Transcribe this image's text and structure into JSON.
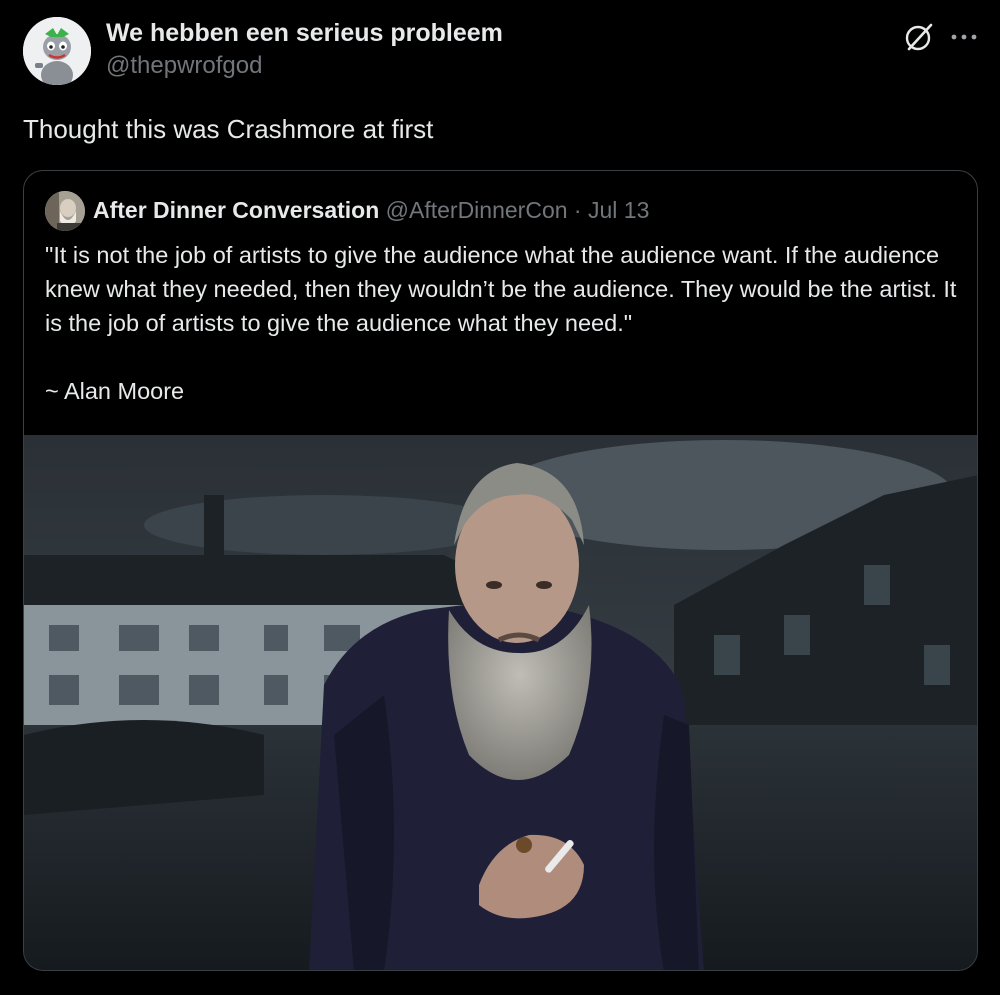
{
  "tweet": {
    "display_name": "We hebben een serieus probleem",
    "handle": "@thepwrofgod",
    "text": "Thought this was Crashmore at first",
    "icons": [
      "avatar",
      "grok-icon",
      "more-icon"
    ]
  },
  "quoted_tweet": {
    "display_name": "After Dinner Conversation",
    "handle": "@AfterDinnerCon",
    "separator": "·",
    "date": "Jul 13",
    "quote_text": "\"It is not the job of artists to give the audience what the audience want. If the audience knew what they needed, then they wouldn’t be the audience. They would be the artist. It is the job of artists to give the audience what they need.\"",
    "attribution": "~ Alan Moore",
    "media": "photo"
  },
  "colors": {
    "background": "#000000",
    "text": "#e7e9ea",
    "secondary_text": "#71767b",
    "border": "#3a3f44"
  }
}
